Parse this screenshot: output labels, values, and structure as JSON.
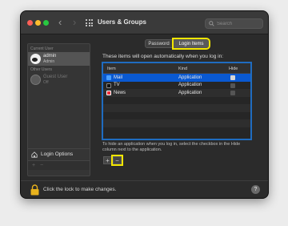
{
  "window": {
    "title": "Users & Groups"
  },
  "search": {
    "placeholder": "Search"
  },
  "sidebar": {
    "current_user_label": "Current User",
    "current_user": {
      "name": "admin",
      "role": "Admin"
    },
    "other_users_label": "Other Users",
    "guest_user": {
      "name": "Guest User",
      "status": "Off"
    },
    "login_options_label": "Login Options",
    "add_button": "+",
    "remove_button": "−"
  },
  "tabs": [
    {
      "label": "Password",
      "selected": false
    },
    {
      "label": "Login Items",
      "selected": true
    }
  ],
  "login_items": {
    "description": "These items will open automatically when you log in:",
    "columns": {
      "item": "Item",
      "kind": "Kind",
      "hide": "Hide"
    },
    "rows": [
      {
        "item": "Mail",
        "kind": "Application",
        "hide": false,
        "icon": "mail-icon",
        "selected": true
      },
      {
        "item": "TV",
        "kind": "Application",
        "hide": false,
        "icon": "tv-icon",
        "selected": false
      },
      {
        "item": "News",
        "kind": "Application",
        "hide": false,
        "icon": "news-icon",
        "selected": false
      }
    ],
    "hint": "To hide an application when you log in, select the checkbox in the Hide column next to the application.",
    "add_button": "+",
    "remove_button": "−"
  },
  "footer": {
    "lock_text": "Click the lock to make changes.",
    "help_label": "?"
  },
  "colors": {
    "accent_blue": "#0a59d1",
    "highlight_yellow": "#f3e600",
    "window_bg": "#2b2b2b"
  }
}
